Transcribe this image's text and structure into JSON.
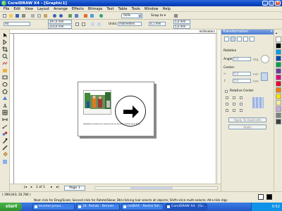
{
  "window": {
    "title": "CorelDRAW X4 - [Graphic1]"
  },
  "window_controls": {
    "minimize": "_",
    "maximize": "□",
    "close": "×"
  },
  "menu": [
    "File",
    "Edit",
    "View",
    "Layout",
    "Arrange",
    "Effects",
    "Bitmaps",
    "Text",
    "Table",
    "Tools",
    "Window",
    "Help"
  ],
  "toolbar": {
    "zoom_value": "50%",
    "snap_to_label": "Snap to"
  },
  "property_bar": {
    "paper_size": "A4",
    "width": "297,0 mm",
    "height": "210,0 mm",
    "units_label": "Units:",
    "units_value": "millimeters",
    "nudge": "0,1 mm",
    "dup_x": "5,0 mm",
    "dup_y": "5,0 mm"
  },
  "ruler": {
    "unit": "millimeters"
  },
  "document": {
    "caption": "Sabethere X paisa da rs alianza ariunni dondhtyc balule yoloa belar"
  },
  "docker": {
    "title": "Transformation",
    "rotation_label": "Rotation",
    "angle_label": "Angle:",
    "angle_value": "0,0",
    "angle_unit": "deg",
    "center_label": "Center:",
    "center_x": "0,0",
    "center_y": "0,0",
    "center_unit": "mm",
    "relative_center_label": "Relative Center",
    "apply_to_duplicate_label": "Apply To Duplicate",
    "apply_label": "Apply",
    "close_glyph": "×"
  },
  "palette": {
    "colors": [
      "#ffffff",
      "#000000",
      "#00a0e8",
      "#004aa8",
      "#00a050",
      "#6a3aa0",
      "#e0007a",
      "#e8002a",
      "#f07a00",
      "#ffe000",
      "#f2e8a0",
      "#c8a8d8",
      "#808080",
      "#404040"
    ]
  },
  "pages": {
    "position": "1 of 1",
    "current_tab": "Page 1",
    "first": "|◂",
    "prev": "◂",
    "next": "▸",
    "last": "▸|"
  },
  "status": {
    "coordinates": "( 399,043; 20,784 )",
    "hint": "Next click for Drag/Scale; Second click for Rotate/Skew; Dbl-clicking tool selects all objects; Shift+click multi-selects; Alt+click digs"
  },
  "taskbar": {
    "start_label": "start",
    "tasks": [
      "Income Jurusi...",
      "24. Rahab - Beraler ...",
      "netBAX - Rental Sel...",
      "CorelDRAW X4 - [Gr..."
    ],
    "clock": "0:52"
  }
}
